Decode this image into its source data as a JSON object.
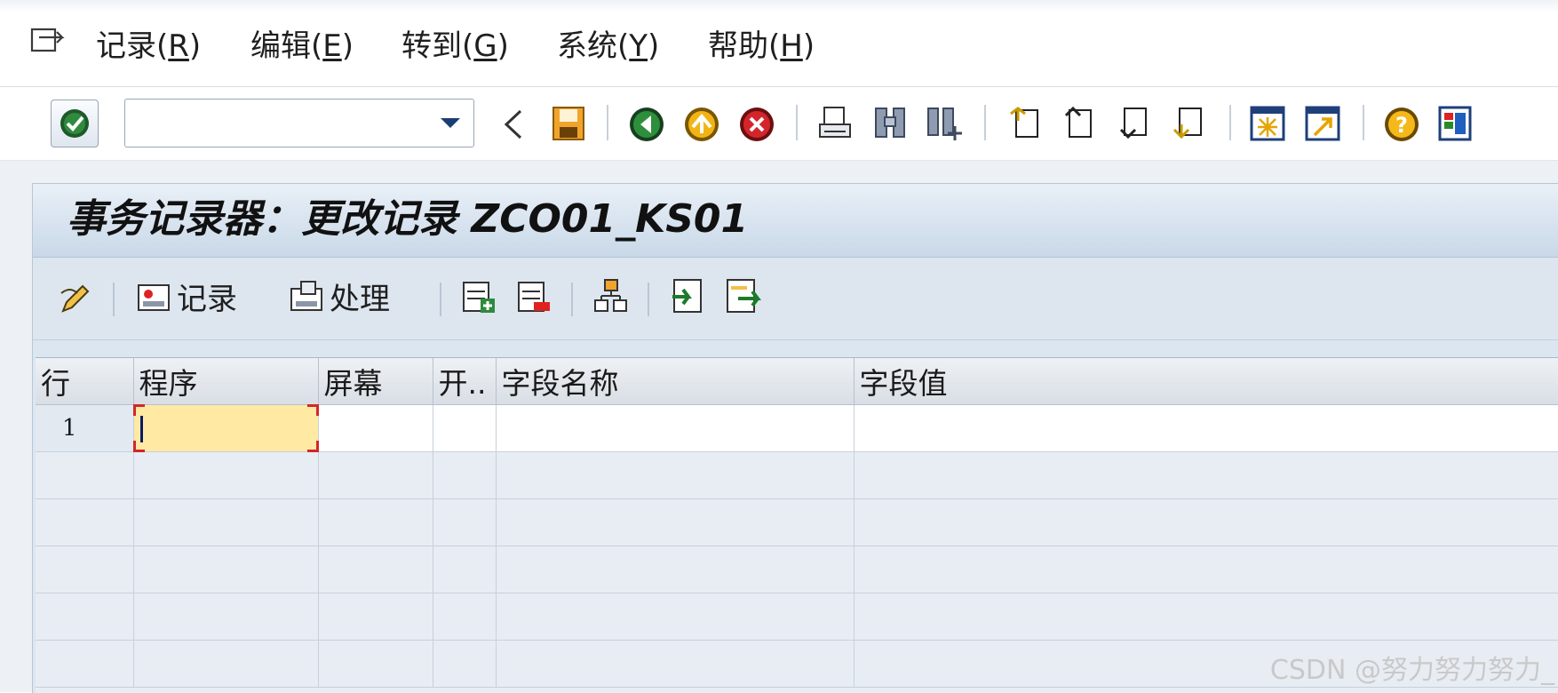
{
  "menu": {
    "items": [
      {
        "label": "记录(",
        "acc": "R",
        "tail": ")"
      },
      {
        "label": "编辑(",
        "acc": "E",
        "tail": ")"
      },
      {
        "label": "转到(",
        "acc": "G",
        "tail": ")"
      },
      {
        "label": "系统(",
        "acc": "Y",
        "tail": ")"
      },
      {
        "label": "帮助(",
        "acc": "H",
        "tail": ")"
      }
    ]
  },
  "toolbar": {
    "command_field_value": "",
    "icons": [
      "enter-icon",
      "command-dropdown-icon",
      "back-triangle-icon",
      "save-icon",
      "back-icon",
      "exit-icon",
      "cancel-icon",
      "print-icon",
      "find-icon",
      "find-next-icon",
      "first-page-icon",
      "previous-page-icon",
      "next-page-icon",
      "last-page-icon",
      "new-session-icon",
      "create-shortcut-icon",
      "help-icon",
      "layout-icon"
    ]
  },
  "page": {
    "title": "事务记录器：更改记录 ZCO01_KS01"
  },
  "app_toolbar": {
    "record_label": "记录",
    "process_label": "处理"
  },
  "table": {
    "columns": [
      "行",
      "程序",
      "屏幕",
      "开..",
      "字段名称",
      "字段值"
    ],
    "rows": [
      {
        "line": "1",
        "program": "",
        "screen": "",
        "start": "",
        "field_name": "",
        "field_value": ""
      }
    ]
  },
  "watermark": "CSDN @努力努力努力_",
  "colors": {
    "active_cell": "#ffe9a3",
    "focus_corner": "#d2262a",
    "title_bar": "#c9d8e8"
  }
}
